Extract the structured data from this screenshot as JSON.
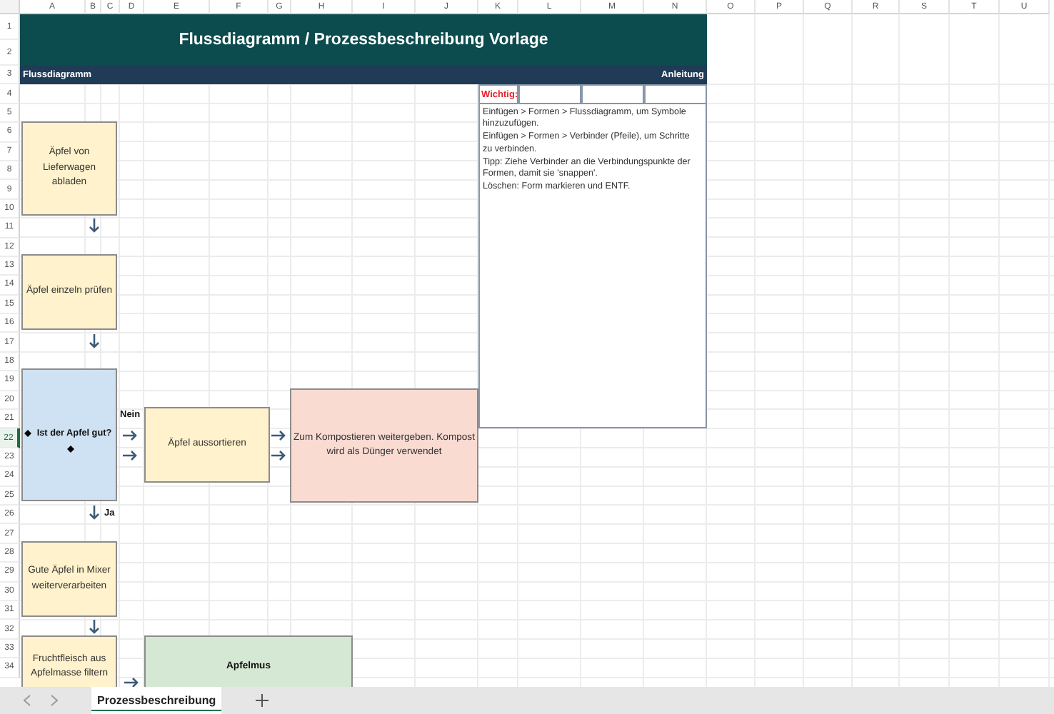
{
  "title": "Flussdiagramm / Prozessbeschreibung Vorlage",
  "columns": [
    "A",
    "B",
    "C",
    "D",
    "E",
    "F",
    "G",
    "H",
    "I",
    "J",
    "K",
    "L",
    "M",
    "N",
    "O",
    "P",
    "Q",
    "R",
    "S",
    "T",
    "U"
  ],
  "rows": [
    "1",
    "2",
    "3",
    "4",
    "5",
    "6",
    "7",
    "8",
    "9",
    "10",
    "11",
    "12",
    "13",
    "14",
    "15",
    "16",
    "17",
    "18",
    "19",
    "20",
    "21",
    "22",
    "23",
    "24",
    "25",
    "26",
    "27",
    "28",
    "29",
    "30",
    "31",
    "32",
    "33",
    "34"
  ],
  "section_bar": {
    "left": "Flussdiagramm",
    "right": "Anleitung"
  },
  "instructions": {
    "label": "Wichtig:",
    "lines": [
      "Einfügen > Formen > Flussdiagramm, um Symbole hinzuzufügen.",
      "Einfügen > Formen > Verbinder (Pfeile), um Schritte zu verbinden.",
      "Tipp: Ziehe Verbinder an die Verbindungspunkte der Formen, damit sie 'snappen'.",
      "Löschen: Form markieren und ENTF."
    ]
  },
  "shapes": [
    {
      "kind": "process",
      "text": "Äpfel von Lieferwagen abladen",
      "color": "#fff2cc"
    },
    {
      "kind": "process",
      "text": "Äpfel einzeln prüfen",
      "color": "#fff2cc"
    },
    {
      "kind": "decision",
      "text": "Ist der Apfel gut?",
      "color": "#cfe2f3"
    },
    {
      "kind": "process",
      "text": "Äpfel aussortieren",
      "color": "#fff2cc"
    },
    {
      "kind": "process",
      "text": "Zum Kompostieren weitergeben. Kompost wird als Dünger verwendet",
      "color": "#fadbd2"
    },
    {
      "kind": "process",
      "text": "Gute Äpfel in Mixer weiterverarbeiten",
      "color": "#fff2cc"
    },
    {
      "kind": "process",
      "text": "Fruchtfleisch aus Apfelmasse filtern",
      "color": "#fff2cc"
    },
    {
      "kind": "result",
      "text": "Apfelmus",
      "color": "#d5e8d4"
    }
  ],
  "branch_labels": [
    "Nein",
    "Ja"
  ],
  "sheet_tabs": [
    {
      "label": "Prozessbeschreibung",
      "selected": true
    }
  ]
}
